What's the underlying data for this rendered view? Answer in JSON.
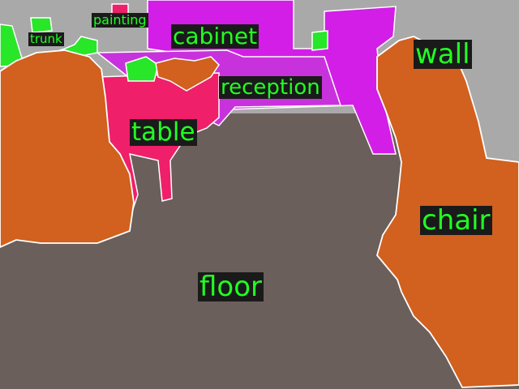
{
  "colors": {
    "label_text": "#22ff22",
    "label_bg": "#1a1a1a",
    "floor": "#6b5f5b",
    "chair": "#d2601e",
    "table": "#ef1f6a",
    "cabinet": "#d21ee6",
    "reception": "#c832dc",
    "trunk_painting": "#28e628",
    "wall": "#a9a9a9",
    "outline": "#ffffff"
  },
  "labels": {
    "painting": "painting",
    "trunk": "trunk",
    "cabinet": "cabinet",
    "reception": "reception",
    "wall": "wall",
    "table": "table",
    "chair": "chair",
    "floor": "floor"
  }
}
